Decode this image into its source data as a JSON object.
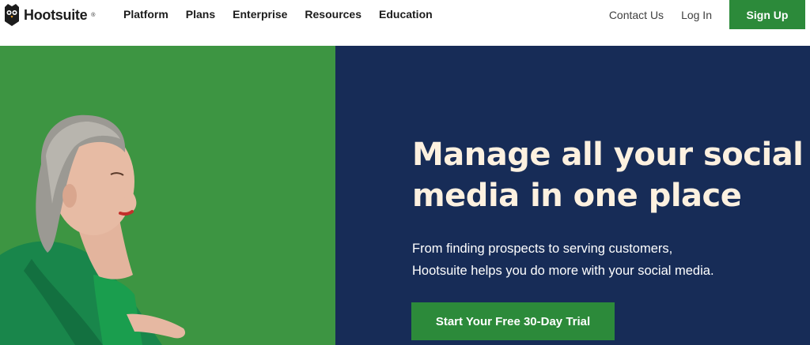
{
  "nav": {
    "brand": "Hootsuite",
    "brand_mark": "®",
    "items": [
      {
        "label": "Platform"
      },
      {
        "label": "Plans"
      },
      {
        "label": "Enterprise"
      },
      {
        "label": "Resources"
      },
      {
        "label": "Education"
      }
    ],
    "contact_label": "Contact Us",
    "login_label": "Log In",
    "signup_label": "Sign Up"
  },
  "hero": {
    "headline_line1": "Manage all your social",
    "headline_line2": "media in one place",
    "subtext_line1": "From finding prospects to serving customers,",
    "subtext_line2": "Hootsuite helps you do more with your social media.",
    "cta_label": "Start Your Free 30-Day Trial"
  },
  "colors": {
    "brand_green": "#2c8a3a",
    "hero_green": "#3d9542",
    "hero_navy": "#172c57",
    "headline_cream": "#fdf1e0"
  },
  "icons": {
    "logo": "owl-logo-icon"
  }
}
